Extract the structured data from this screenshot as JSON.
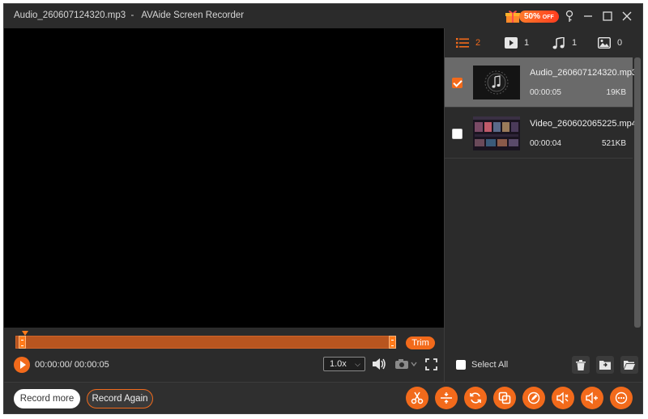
{
  "window": {
    "title_file": "Audio_260607124320.mp3",
    "title_app": "AVAide Screen Recorder"
  },
  "promo": {
    "label": "50%",
    "suffix": "OFF"
  },
  "player": {
    "time": "00:00:00/ 00:00:05",
    "speed": "1.0x",
    "trim_label": "Trim"
  },
  "tabs": [
    {
      "icon": "list-icon",
      "count": "2"
    },
    {
      "icon": "video-icon",
      "count": "1"
    },
    {
      "icon": "music-icon",
      "count": "1"
    },
    {
      "icon": "image-icon",
      "count": "0"
    }
  ],
  "files": [
    {
      "name": "Audio_260607124320.mp3",
      "duration": "00:00:05",
      "size": "19KB",
      "checked": true
    },
    {
      "name": "Video_260602065225.mp4",
      "duration": "00:00:04",
      "size": "521KB",
      "checked": false
    }
  ],
  "panel": {
    "select_all": "Select All"
  },
  "bottom": {
    "record_more": "Record more",
    "record_again": "Record Again"
  },
  "colors": {
    "accent": "#f26a1b",
    "background": "#2b2b2b",
    "player": "#000000"
  }
}
